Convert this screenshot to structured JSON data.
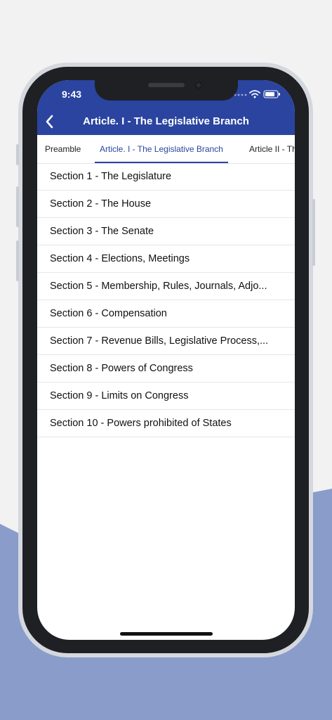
{
  "status_bar": {
    "time": "9:43"
  },
  "header": {
    "title": "Article. I - The Legislative Branch"
  },
  "tabs": [
    {
      "label": "Preamble"
    },
    {
      "label": "Article. I - The Legislative Branch"
    },
    {
      "label": "Article II - The Executive Branch"
    }
  ],
  "sections": [
    {
      "label": "Section 1 - The Legislature"
    },
    {
      "label": "Section 2 - The House"
    },
    {
      "label": "Section 3 - The Senate"
    },
    {
      "label": "Section 4 - Elections, Meetings"
    },
    {
      "label": "Section 5 - Membership, Rules, Journals, Adjo..."
    },
    {
      "label": "Section 6 - Compensation"
    },
    {
      "label": "Section 7 - Revenue Bills, Legislative Process,..."
    },
    {
      "label": "Section 8 - Powers of Congress"
    },
    {
      "label": "Section 9 - Limits on Congress"
    },
    {
      "label": "Section 10 - Powers prohibited of States"
    }
  ],
  "colors": {
    "brand": "#2a44a0",
    "backdrop_accent": "#8a9cca"
  },
  "icons": {
    "back": "chevron-left-icon",
    "signal": "signal-icon",
    "wifi": "wifi-icon",
    "battery": "battery-icon"
  }
}
